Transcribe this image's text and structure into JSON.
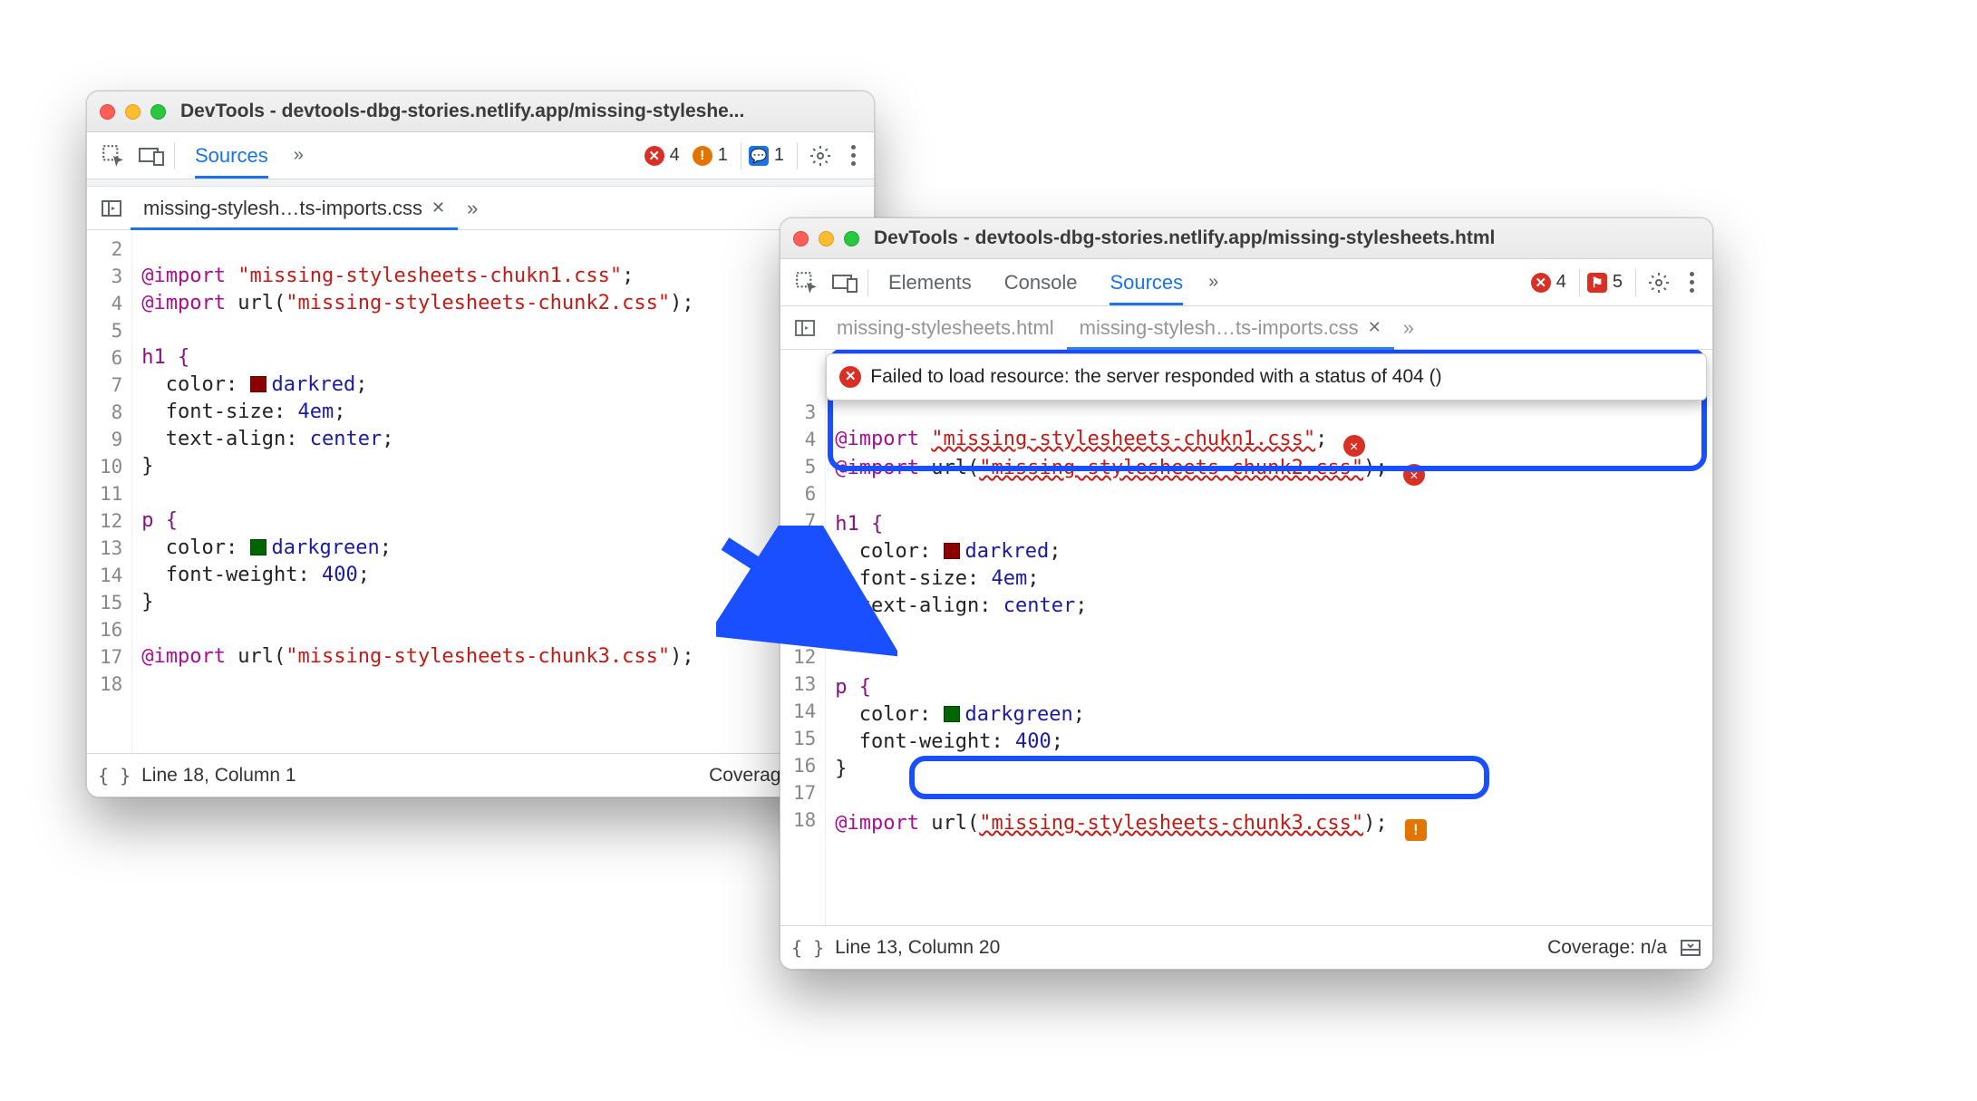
{
  "windows": {
    "left": {
      "title": "DevTools - devtools-dbg-stories.netlify.app/missing-styleshe...",
      "activeTab": "Sources",
      "badges": {
        "errors": "4",
        "warnings": "1",
        "info": "1"
      },
      "fileTab": "missing-stylesh…ts-imports.css",
      "lines_start": 2,
      "lines_end": 18,
      "code": {
        "l3": {
          "import": "@import",
          "str": "\"missing-stylesheets-chukn1.css\"",
          "tail": ";"
        },
        "l4": {
          "import": "@import",
          "urlw": "url(",
          "str": "\"missing-stylesheets-chunk2.css\"",
          "urle": ")",
          "tail": ";"
        },
        "l6": "h1 {",
        "l7": {
          "prop": "color",
          "sw": "darkred",
          "val": "darkred",
          "tail": ";"
        },
        "l8": {
          "prop": "font-size",
          "val": "4em",
          "tail": ";"
        },
        "l9": {
          "prop": "text-align",
          "val": "center",
          "tail": ";"
        },
        "l10": "}",
        "l12": "p {",
        "l13": {
          "prop": "color",
          "sw": "darkgreen",
          "val": "darkgreen",
          "tail": ";"
        },
        "l14": {
          "prop": "font-weight",
          "val": "400",
          "tail": ";"
        },
        "l15": "}",
        "l17": {
          "import": "@import",
          "urlw": "url(",
          "str": "\"missing-stylesheets-chunk3.css\"",
          "urle": ")",
          "tail": ";"
        }
      },
      "status": {
        "pos": "Line 18, Column 1",
        "coverage": "Coverage: n/a"
      }
    },
    "right": {
      "title": "DevTools - devtools-dbg-stories.netlify.app/missing-stylesheets.html",
      "tabs": [
        "Elements",
        "Console",
        "Sources"
      ],
      "activeTab": "Sources",
      "badges": {
        "errors": "4",
        "issues": "5"
      },
      "fileTabs": [
        "missing-stylesheets.html",
        "missing-stylesh…ts-imports.css"
      ],
      "activeFileTab": 1,
      "tooltip": "Failed to load resource: the server responded with a status of 404 ()",
      "lines_start": 3,
      "lines_end": 18,
      "code": {
        "l3": {
          "import": "@import",
          "str": "\"missing-stylesheets-chukn1.css\"",
          "tail": ";",
          "err": true
        },
        "l4": {
          "import": "@import",
          "urlw": "url(",
          "str": "\"missing-stylesheets-chunk2.css\"",
          "urle": ")",
          "tail": ";",
          "err": true
        },
        "l6": "h1 {",
        "l7": {
          "prop": "color",
          "sw": "darkred",
          "val": "darkred",
          "tail": ";"
        },
        "l8": {
          "prop": "font-size",
          "val": "4em",
          "tail": ";"
        },
        "l9": {
          "prop": "text-align",
          "val": "center",
          "tail": ";"
        },
        "l10": "}",
        "l12": "p {",
        "l13": {
          "prop": "color",
          "sw": "darkgreen",
          "val": "darkgreen",
          "tail": ";"
        },
        "l14": {
          "prop": "font-weight",
          "val": "400",
          "tail": ";"
        },
        "l15": "}",
        "l17": {
          "import": "@import",
          "urlw": "url(",
          "str": "\"missing-stylesheets-chunk3.css\"",
          "urle": ")",
          "tail": ";",
          "warn": true
        }
      },
      "status": {
        "pos": "Line 13, Column 20",
        "coverage": "Coverage: n/a"
      }
    }
  }
}
